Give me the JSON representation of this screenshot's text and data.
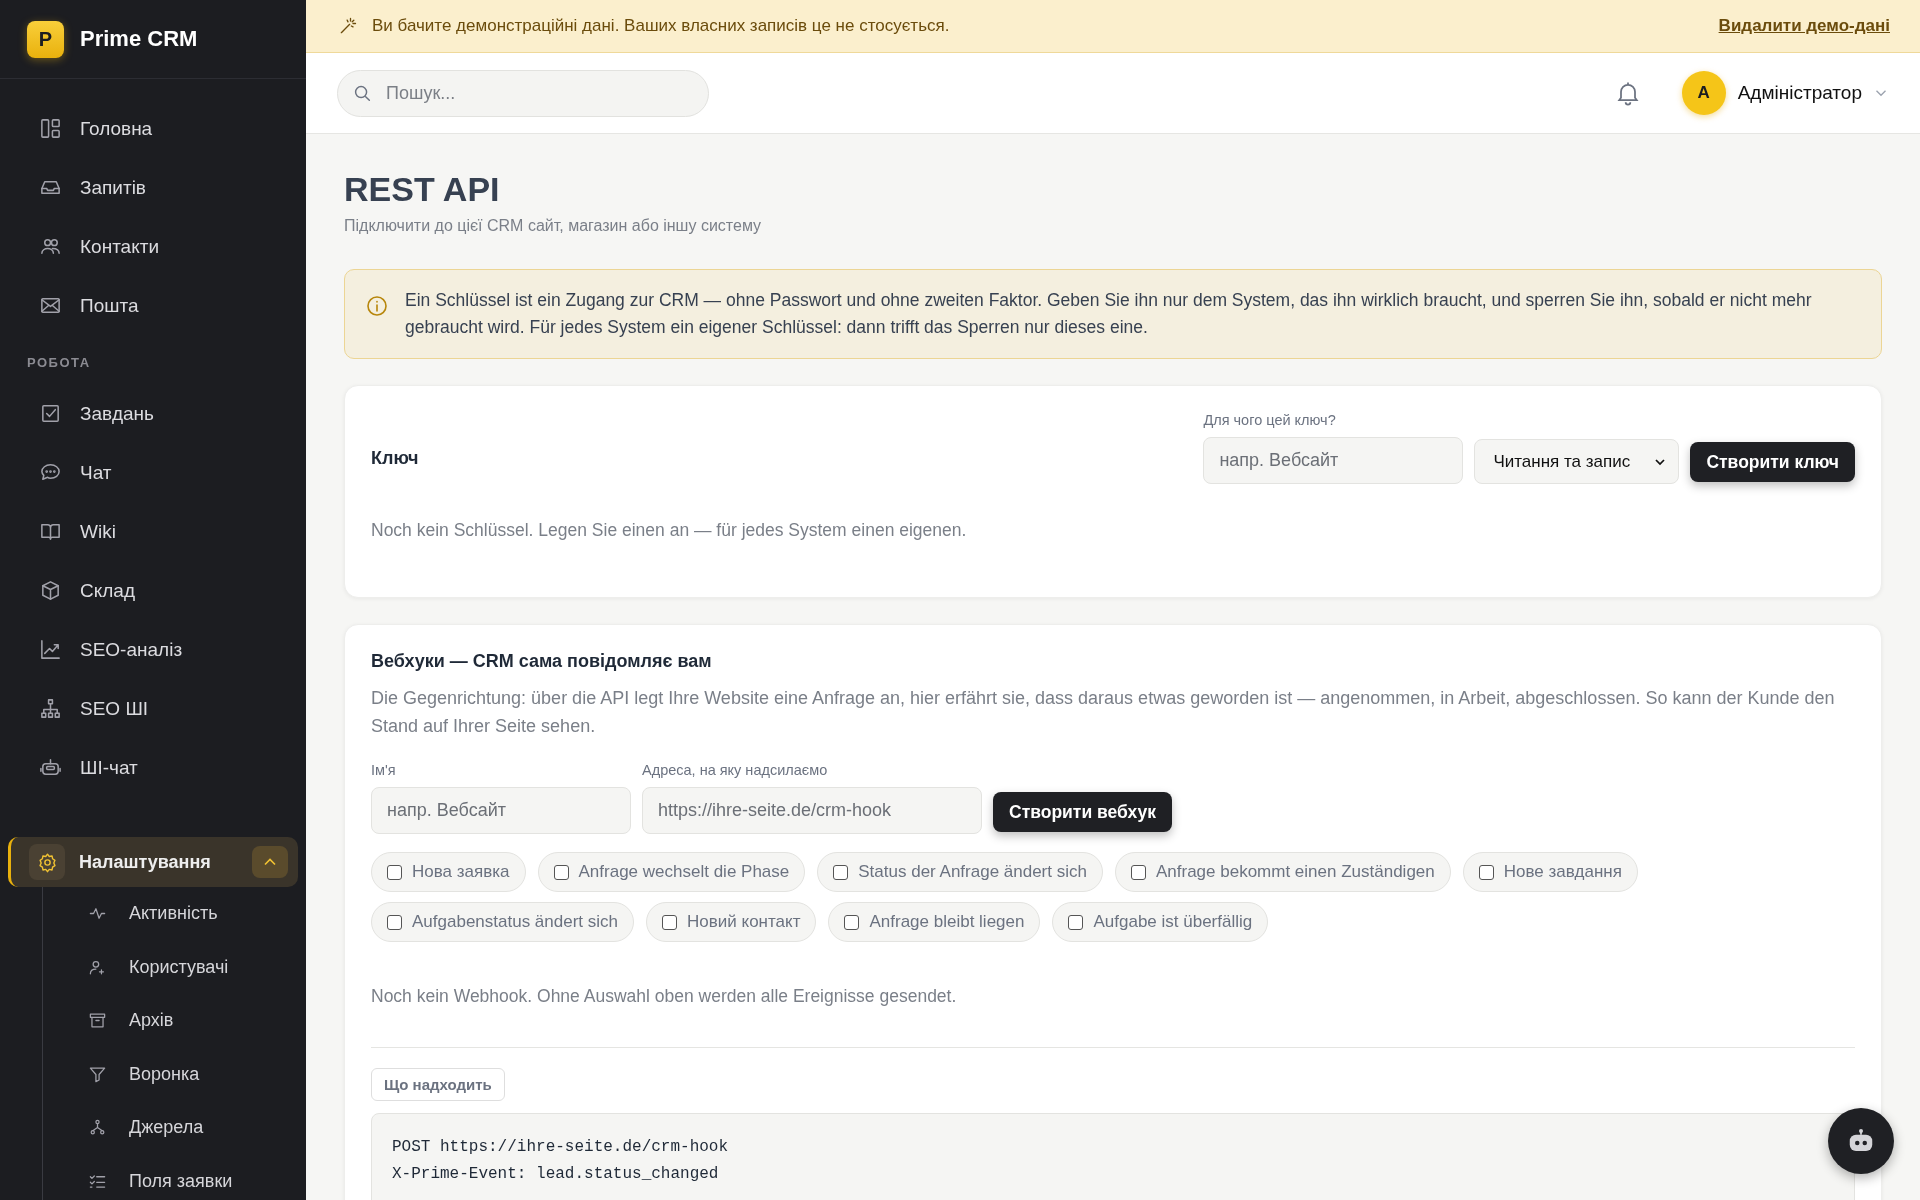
{
  "sidebar": {
    "brand": {
      "logo_letter": "P",
      "name": "Prime CRM"
    },
    "main_items": [
      {
        "label": "Головна",
        "selected": false
      },
      {
        "label": "Запитів",
        "selected": false
      },
      {
        "label": "Контакти",
        "selected": false
      },
      {
        "label": "Пошта",
        "selected": false
      }
    ],
    "work_section": {
      "title": "РОБОТА",
      "items": [
        {
          "label": "Завдань",
          "selected": false
        },
        {
          "label": "Чат",
          "selected": false
        },
        {
          "label": "Wiki",
          "selected": false
        },
        {
          "label": "Склад",
          "selected": false
        },
        {
          "label": "SEO-аналіз",
          "selected": false
        },
        {
          "label": "SEO ШІ",
          "selected": false
        },
        {
          "label": "ШІ-чат",
          "selected": false
        }
      ]
    },
    "settings": {
      "label": "Налаштування",
      "selected": true,
      "expanded": true,
      "children": [
        {
          "label": "Активність",
          "selected": false
        },
        {
          "label": "Користувачі",
          "selected": false
        },
        {
          "label": "Архів",
          "selected": false
        },
        {
          "label": "Воронка",
          "selected": false
        },
        {
          "label": "Джерела",
          "selected": false
        },
        {
          "label": "Поля заявки",
          "selected": false
        }
      ]
    }
  },
  "demo_banner": {
    "text": "Ви бачите демонстраційні дані. Ваших власних записів це не стосується.",
    "link": "Видалити демо-дані"
  },
  "header": {
    "search": {
      "placeholder": "Пошук..."
    },
    "user": {
      "initial": "A",
      "name": "Адміністратор"
    }
  },
  "page": {
    "title": "REST API",
    "subtitle": "Підключити до цієї CRM сайт, магазин або іншу систему"
  },
  "notice": "Ein Schlüssel ist ein Zugang zur CRM — ohne Passwort und ohne zweiten Faktor. Geben Sie ihn nur dem System, das ihn wirklich braucht, und sperren Sie ihn, sobald er nicht mehr gebraucht wird. Für jedes System ein eigener Schlüssel: dann trifft das Sperren nur dieses eine.",
  "key_card": {
    "title": "Ключ",
    "purpose_label": "Для чого цей ключ?",
    "purpose_placeholder": "напр. Вебсайт",
    "access_value": "Читання та запис",
    "create_button": "Створити ключ",
    "empty_text": "Noch kein Schlüssel. Legen Sie einen an — für jedes System einen eigenen."
  },
  "webhook_card": {
    "title": "Вебхуки — CRM сама повідомляє вам",
    "description": "Die Gegenrichtung: über die API legt Ihre Website eine Anfrage an, hier erfährt sie, dass daraus etwas geworden ist — angenommen, in Arbeit, abgeschlossen. So kann der Kunde den Stand auf Ihrer Seite sehen.",
    "name_label": "Ім'я",
    "name_placeholder": "напр. Вебсайт",
    "url_label": "Адреса, на яку надсилаємо",
    "url_placeholder": "https://ihre-seite.de/crm-hook",
    "create_button": "Створити вебхук",
    "events": [
      {
        "label": "Нова заявка",
        "checked": false
      },
      {
        "label": "Anfrage wechselt die Phase",
        "checked": false
      },
      {
        "label": "Status der Anfrage ändert sich",
        "checked": false
      },
      {
        "label": "Anfrage bekommt einen Zuständigen",
        "checked": false
      },
      {
        "label": "Нове завдання",
        "checked": false
      },
      {
        "label": "Aufgabenstatus ändert sich",
        "checked": false
      },
      {
        "label": "Новий контакт",
        "checked": false
      },
      {
        "label": "Anfrage bleibt liegen",
        "checked": false
      },
      {
        "label": "Aufgabe ist überfällig",
        "checked": false
      }
    ],
    "empty_text": "Noch kein Webhook. Ohne Auswahl oben werden alle Ereignisse gesendet.",
    "payload_tag": "Що надходить",
    "payload_lines": [
      "POST https://ihre-seite.de/crm-hook",
      "X-Prime-Event: lead.status_changed"
    ]
  }
}
